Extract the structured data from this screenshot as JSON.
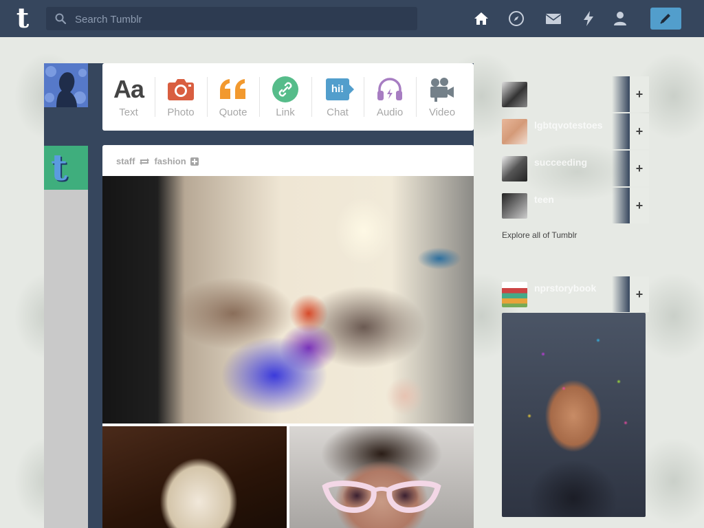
{
  "header": {
    "search_placeholder": "Search Tumblr",
    "logo_letter": "t",
    "nav": [
      "home-icon",
      "explore-compass-icon",
      "inbox-envelope-icon",
      "activity-lightning-icon",
      "account-person-icon",
      "compose-pencil-icon"
    ]
  },
  "post_types": [
    {
      "label": "Text",
      "glyph": "Aa",
      "color": "#444444"
    },
    {
      "label": "Photo",
      "color": "#d95e40"
    },
    {
      "label": "Quote",
      "color": "#f2992e"
    },
    {
      "label": "Link",
      "color": "#56bc8a"
    },
    {
      "label": "Chat",
      "glyph": "hi!",
      "color": "#529ecc"
    },
    {
      "label": "Audio",
      "color": "#a77dc2"
    },
    {
      "label": "Video",
      "color": "#748089"
    }
  ],
  "post": {
    "author": "staff",
    "reblogged_from": "fashion"
  },
  "sidebar": {
    "recommended_title": "",
    "recommended": [
      {
        "name": "",
        "sub": ""
      },
      {
        "name": "lgbtqvotestoes",
        "sub": ""
      },
      {
        "name": "succeeding",
        "sub": ""
      },
      {
        "name": "teen",
        "sub": ""
      }
    ],
    "explore_label": "Explore all of Tumblr",
    "radar_title": "",
    "radar_blog": {
      "name": "nprstorybook",
      "sub": ""
    }
  },
  "colors": {
    "header_bg": "#36465d",
    "accent": "#529ecc"
  }
}
